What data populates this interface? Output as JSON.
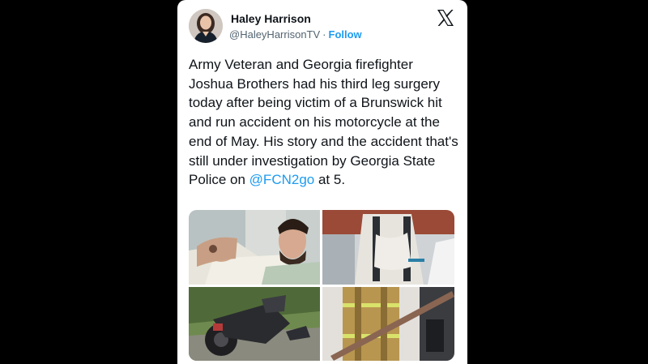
{
  "tweet": {
    "author": {
      "display_name": "Haley Harrison",
      "handle": "@HaleyHarrisonTV",
      "separator": "·",
      "follow_label": "Follow",
      "avatar_icon": "profile-photo"
    },
    "platform_icon": "x-logo-icon",
    "body": {
      "text_before_mention": "Army Veteran and Georgia firefighter Joshua Brothers had his third leg surgery today after being victim of a Brunswick hit and run accident on his motorcycle at the end of May. His story and the accident that's still under investigation by Georgia State Police on ",
      "mention": "@FCN2go",
      "text_after_mention": " at 5."
    },
    "media": [
      {
        "subject": "man-in-hospital-bed-photo"
      },
      {
        "subject": "leg-in-brace-photo"
      },
      {
        "subject": "wrecked-motorcycle-photo"
      },
      {
        "subject": "firefighter-in-gear-photo"
      }
    ]
  },
  "colors": {
    "background": "#000000",
    "card": "#ffffff",
    "text": "#0f1419",
    "secondary_text": "#536471",
    "link": "#1d9bf0"
  }
}
